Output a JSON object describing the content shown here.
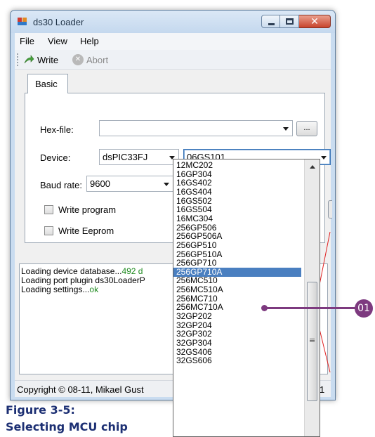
{
  "window": {
    "title": "ds30 Loader",
    "caption_buttons": {
      "close_glyph": "✕"
    }
  },
  "menu": {
    "items": [
      "File",
      "View",
      "Help"
    ]
  },
  "toolbar": {
    "write_label": "Write",
    "abort_label": "Abort",
    "abort_glyph": "✕"
  },
  "tabs": [
    {
      "label": "Basic",
      "active": true
    }
  ],
  "form": {
    "hexfile_label": "Hex-file:",
    "hexfile_value": "",
    "browse_label": "...",
    "device_label": "Device:",
    "device_family": "dsPIC33FJ",
    "device_model": "06GS101",
    "baud_label": "Baud rate:",
    "baud_value": "9600",
    "write_program_label": "Write program",
    "write_program_checked": false,
    "write_eeprom_label": "Write Eeprom",
    "write_eeprom_checked": false
  },
  "log": {
    "lines": [
      {
        "text": "Loading device database...",
        "status": "492 d"
      },
      {
        "text": "Loading port plugin ds30LoaderP",
        "status": ""
      },
      {
        "text": "Loading settings...",
        "status": "ok"
      }
    ]
  },
  "statusbar": {
    "copyright": "Copyright © 08-11, Mikael Gust",
    "right": "1"
  },
  "dropdown": {
    "items": [
      "12MC202",
      "16GP304",
      "16GS402",
      "16GS404",
      "16GS502",
      "16GS504",
      "16MC304",
      "256GP506",
      "256GP506A",
      "256GP510",
      "256GP510A",
      "256GP710",
      "256GP710A",
      "256MC510",
      "256MC510A",
      "256MC710",
      "256MC710A",
      "32GP202",
      "32GP204",
      "32GP302",
      "32GP304",
      "32GS406",
      "32GS606"
    ],
    "selected_index": 12
  },
  "callout": {
    "number": "01"
  },
  "figure_caption": {
    "line1": "Figure 3-5:",
    "line2": "Selecting MCU chip"
  },
  "colors": {
    "callout": "#7d3a7f",
    "selection": "#3399ff",
    "log_ok": "#1e8a1e",
    "caption": "#1c2f73"
  }
}
